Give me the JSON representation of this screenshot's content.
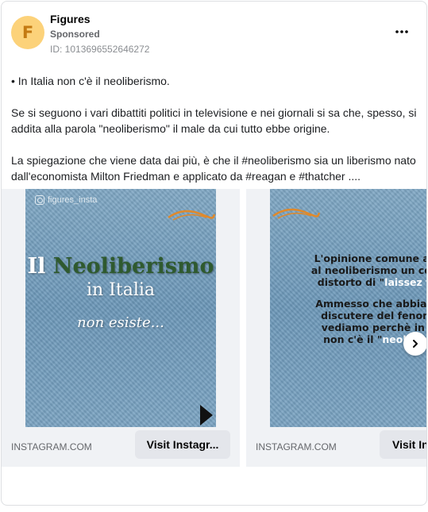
{
  "post": {
    "page_name": "Figures",
    "avatar_letter": "F",
    "sponsored_label": "Sponsored",
    "ad_id": "ID: 1013696552646272",
    "more_icon": "ellipsis-icon",
    "body": {
      "p1": "• In Italia non c'è il neoliberismo.",
      "p2": "Se si seguono i vari dibattiti politici in televisione e nei giornali si sa che, spesso, si addita alla parola \"neoliberismo\" il male da cui tutto ebbe origine.",
      "p3": "La spiegazione che viene data dai più, è che il #neoliberismo sia un liberismo nato dall'economista Milton Friedman e applicato da #reagan e #thatcher ...."
    }
  },
  "carousel": {
    "slides": [
      {
        "watermark": "figures_insta",
        "title_prefix": "Il ",
        "title_accent": "Neoliberismo",
        "title_line2": "in Italia",
        "subline": "non esiste...",
        "domain": "INSTAGRAM.COM",
        "cta_label": "Visit Instagr..."
      },
      {
        "line1": "L'opinione comune associa",
        "line2": "al neoliberismo un concetto",
        "line3_prefix": "distorto di \"",
        "line3_highlight": "laissez faire",
        "line3_suffix": "\".",
        "line4": "Ammesso che abbia senso",
        "line5": "discutere del fenomeno,",
        "line6": "vediamo perchè in Italia",
        "line7_prefix": "non c'è il \"",
        "line7_highlight": "neoliberismo",
        "domain": "INSTAGRAM.COM",
        "cta_label": "Visit Ins"
      }
    ],
    "next_icon": "chevron-right-icon"
  },
  "colors": {
    "denim": "#7aa3c2",
    "accent_green": "#2f5a2f",
    "swoosh_orange": "#e0892a",
    "cta_bg": "#e4e6eb"
  }
}
